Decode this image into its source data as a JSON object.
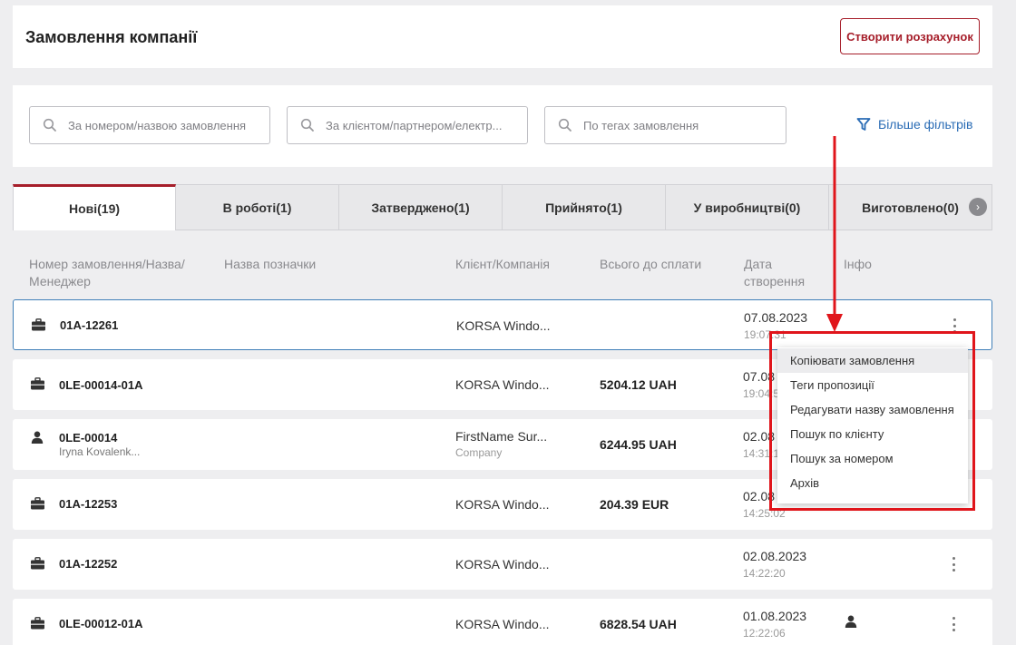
{
  "header": {
    "title": "Замовлення компанії",
    "create_button": "Створити розрахунок"
  },
  "filters": {
    "search_number_placeholder": "За номером/назвою замовлення",
    "search_client_placeholder": "За клієнтом/партнером/електр...",
    "search_tags_placeholder": "По тегах замовлення",
    "more_filters": "Більше фільтрів"
  },
  "tabs": [
    {
      "label": "Нові(19)"
    },
    {
      "label": "В роботі(1)"
    },
    {
      "label": "Затверджено(1)"
    },
    {
      "label": "Прийнято(1)"
    },
    {
      "label": "У виробництві(0)"
    },
    {
      "label": "Виготовлено(0)"
    }
  ],
  "columns": {
    "number": "Номер замовлення/Назва/Менеджер",
    "mark": "Назва позначки",
    "client": "Клієнт/Компанія",
    "total": "Всього до сплати",
    "date": "Дата створення",
    "info": "Інфо"
  },
  "rows": [
    {
      "icon": "briefcase-icon",
      "number": "01A-12261",
      "manager": "",
      "client": "KORSA Windo...",
      "company": "",
      "total": "",
      "date": "07.08.2023",
      "time": "19:07:31"
    },
    {
      "icon": "briefcase-icon",
      "number": "0LE-00014-01A",
      "manager": "",
      "client": "KORSA Windo...",
      "company": "",
      "total": "5204.12 UAH",
      "date": "07.08",
      "time": "19:04:5"
    },
    {
      "icon": "user-icon",
      "number": "0LE-00014",
      "manager": "Iryna Kovalenk...",
      "client": "FirstName Sur...",
      "company": "Company",
      "total": "6244.95 UAH",
      "date": "02.08",
      "time": "14:31:1"
    },
    {
      "icon": "briefcase-icon",
      "number": "01A-12253",
      "manager": "",
      "client": "KORSA Windo...",
      "company": "",
      "total": "204.39 EUR",
      "date": "02.08",
      "time": "14:25:02"
    },
    {
      "icon": "briefcase-icon",
      "number": "01A-12252",
      "manager": "",
      "client": "KORSA Windo...",
      "company": "",
      "total": "",
      "date": "02.08.2023",
      "time": "14:22:20"
    },
    {
      "icon": "briefcase-icon",
      "number": "0LE-00012-01A",
      "manager": "",
      "client": "KORSA Windo...",
      "company": "",
      "total": "6828.54 UAH",
      "date": "01.08.2023",
      "time": "12:22:06",
      "info_icon": "user-icon"
    }
  ],
  "context_menu": {
    "items": [
      {
        "label": "Копіювати замовлення"
      },
      {
        "label": "Теги пропозиції"
      },
      {
        "label": "Редагувати назву замовлення"
      },
      {
        "label": "Пошук по клієнту"
      },
      {
        "label": "Пошук за номером"
      },
      {
        "label": "Архів"
      }
    ]
  },
  "colors": {
    "brand": "#a61e2a",
    "link": "#2a6cb5",
    "annotation": "#e0151b"
  }
}
